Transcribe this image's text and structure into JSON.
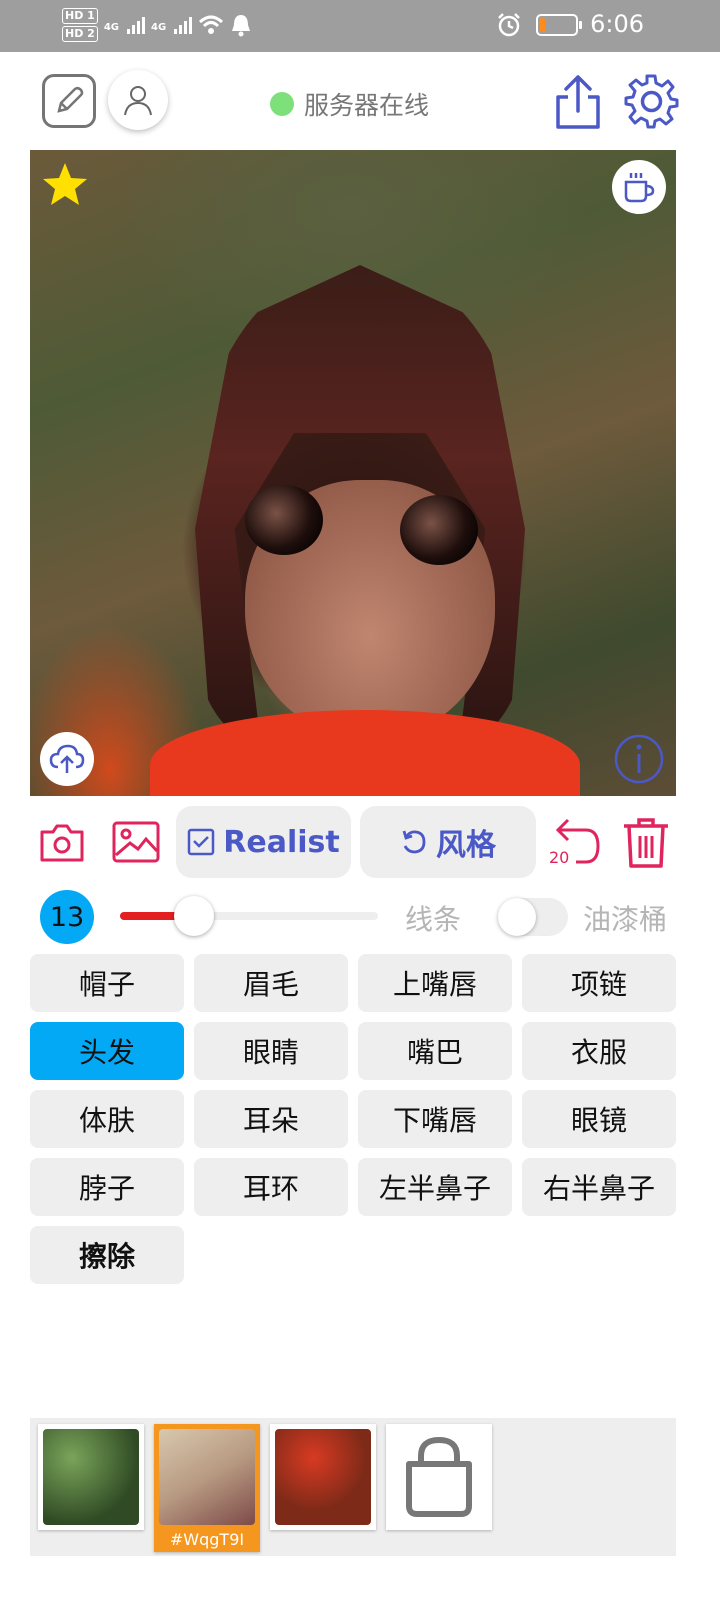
{
  "status_bar": {
    "hd1": "HD 1",
    "hd2": "HD 2",
    "net1": "4G",
    "net2": "4G",
    "time": "6:06",
    "battery_level": 0.15
  },
  "header": {
    "server_status": "服务器在线",
    "status_color": "#7ee07a"
  },
  "toolbar": {
    "realist_label": "Realist",
    "style_label": "风格",
    "undo_count": "20"
  },
  "brush": {
    "size": "13",
    "slider_fraction": 0.2,
    "lines_label": "线条",
    "bucket_label": "油漆桶",
    "bucket_enabled": false
  },
  "parts": [
    {
      "label": "帽子"
    },
    {
      "label": "眉毛"
    },
    {
      "label": "上嘴唇"
    },
    {
      "label": "项链"
    },
    {
      "label": "头发",
      "active": true
    },
    {
      "label": "眼睛"
    },
    {
      "label": "嘴巴"
    },
    {
      "label": "衣服"
    },
    {
      "label": "体肤"
    },
    {
      "label": "耳朵"
    },
    {
      "label": "下嘴唇"
    },
    {
      "label": "眼镜"
    },
    {
      "label": "脖子"
    },
    {
      "label": "耳环"
    },
    {
      "label": "左半鼻子"
    },
    {
      "label": "右半鼻子"
    },
    {
      "label": "擦除",
      "bold": true
    }
  ],
  "gallery": {
    "selected_tag": "#WqgT9I"
  },
  "colors": {
    "accent_blue": "#03a9f4",
    "accent_pink": "#e0245e",
    "primary_indigo": "#4b59c7",
    "star": "#ffe000"
  }
}
